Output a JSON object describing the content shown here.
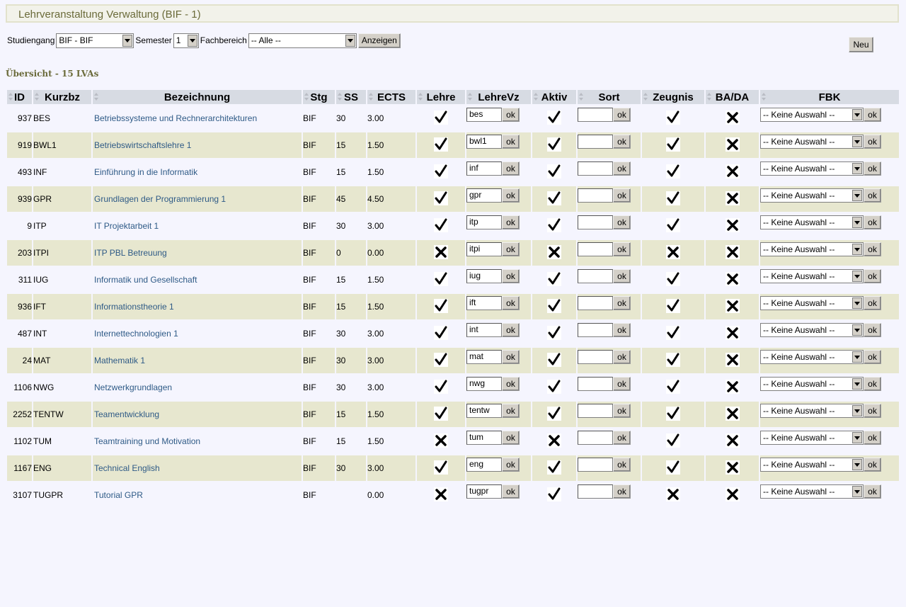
{
  "header": {
    "title": "Lehrveranstaltung Verwaltung (BIF - 1)"
  },
  "filters": {
    "studiengang_label": "Studiengang",
    "studiengang_value": "BIF - BIF",
    "semester_label": "Semester",
    "semester_value": "1",
    "fachbereich_label": "Fachbereich",
    "fachbereich_value": "-- Alle --",
    "show_button": "Anzeigen"
  },
  "new_button": "Neu",
  "overview": "Übersicht - 15 LVAs",
  "columns": [
    "ID",
    "Kurzbz",
    "Bezeichnung",
    "Stg",
    "SS",
    "ECTS",
    "Lehre",
    "LehreVz",
    "Aktiv",
    "Sort",
    "Zeugnis",
    "BA/DA",
    "FBK"
  ],
  "ok_label": "ok",
  "fbk_default": "-- Keine Auswahl --",
  "colors": {
    "check": "#000000",
    "row_alt": "#e7e7cf",
    "link": "#2e5a86",
    "title": "#6b6b3a"
  },
  "rows": [
    {
      "id": "937",
      "kurzbz": "BES",
      "bezeichnung": "Betriebssysteme und Rechnerarchitekturen",
      "stg": "BIF",
      "ss": "30",
      "ects": "3.00",
      "lehre": true,
      "lehrevz": "bes",
      "aktiv": true,
      "sort": "",
      "zeugnis": true,
      "bada": false
    },
    {
      "id": "919",
      "kurzbz": "BWL1",
      "bezeichnung": "Betriebswirtschaftslehre 1",
      "stg": "BIF",
      "ss": "15",
      "ects": "1.50",
      "lehre": true,
      "lehrevz": "bwl1",
      "aktiv": true,
      "sort": "",
      "zeugnis": true,
      "bada": false
    },
    {
      "id": "493",
      "kurzbz": "INF",
      "bezeichnung": "Einführung in die Informatik",
      "stg": "BIF",
      "ss": "15",
      "ects": "1.50",
      "lehre": true,
      "lehrevz": "inf",
      "aktiv": true,
      "sort": "",
      "zeugnis": true,
      "bada": false
    },
    {
      "id": "939",
      "kurzbz": "GPR",
      "bezeichnung": "Grundlagen der Programmierung 1",
      "stg": "BIF",
      "ss": "45",
      "ects": "4.50",
      "lehre": true,
      "lehrevz": "gpr",
      "aktiv": true,
      "sort": "",
      "zeugnis": true,
      "bada": false
    },
    {
      "id": "9",
      "kurzbz": "ITP",
      "bezeichnung": "IT Projektarbeit 1",
      "stg": "BIF",
      "ss": "30",
      "ects": "3.00",
      "lehre": true,
      "lehrevz": "itp",
      "aktiv": true,
      "sort": "",
      "zeugnis": true,
      "bada": false
    },
    {
      "id": "203",
      "kurzbz": "ITPI",
      "bezeichnung": "ITP PBL Betreuung",
      "stg": "BIF",
      "ss": "0",
      "ects": "0.00",
      "lehre": false,
      "lehrevz": "itpi",
      "aktiv": false,
      "sort": "",
      "zeugnis": false,
      "bada": false
    },
    {
      "id": "311",
      "kurzbz": "IUG",
      "bezeichnung": "Informatik und Gesellschaft",
      "stg": "BIF",
      "ss": "15",
      "ects": "1.50",
      "lehre": true,
      "lehrevz": "iug",
      "aktiv": true,
      "sort": "",
      "zeugnis": true,
      "bada": false
    },
    {
      "id": "936",
      "kurzbz": "IFT",
      "bezeichnung": "Informationstheorie 1",
      "stg": "BIF",
      "ss": "15",
      "ects": "1.50",
      "lehre": true,
      "lehrevz": "ift",
      "aktiv": true,
      "sort": "",
      "zeugnis": true,
      "bada": false
    },
    {
      "id": "487",
      "kurzbz": "INT",
      "bezeichnung": "Internettechnologien 1",
      "stg": "BIF",
      "ss": "30",
      "ects": "3.00",
      "lehre": true,
      "lehrevz": "int",
      "aktiv": true,
      "sort": "",
      "zeugnis": true,
      "bada": false
    },
    {
      "id": "24",
      "kurzbz": "MAT",
      "bezeichnung": "Mathematik 1",
      "stg": "BIF",
      "ss": "30",
      "ects": "3.00",
      "lehre": true,
      "lehrevz": "mat",
      "aktiv": true,
      "sort": "",
      "zeugnis": true,
      "bada": false
    },
    {
      "id": "1106",
      "kurzbz": "NWG",
      "bezeichnung": "Netzwerkgrundlagen",
      "stg": "BIF",
      "ss": "30",
      "ects": "3.00",
      "lehre": true,
      "lehrevz": "nwg",
      "aktiv": true,
      "sort": "",
      "zeugnis": true,
      "bada": false
    },
    {
      "id": "2252",
      "kurzbz": "TENTW",
      "bezeichnung": "Teamentwicklung",
      "stg": "BIF",
      "ss": "15",
      "ects": "1.50",
      "lehre": true,
      "lehrevz": "tentw",
      "aktiv": true,
      "sort": "",
      "zeugnis": true,
      "bada": false
    },
    {
      "id": "1102",
      "kurzbz": "TUM",
      "bezeichnung": "Teamtraining und Motivation",
      "stg": "BIF",
      "ss": "15",
      "ects": "1.50",
      "lehre": false,
      "lehrevz": "tum",
      "aktiv": false,
      "sort": "",
      "zeugnis": true,
      "bada": false
    },
    {
      "id": "1167",
      "kurzbz": "ENG",
      "bezeichnung": "Technical English",
      "stg": "BIF",
      "ss": "30",
      "ects": "3.00",
      "lehre": true,
      "lehrevz": "eng",
      "aktiv": true,
      "sort": "",
      "zeugnis": true,
      "bada": false
    },
    {
      "id": "3107",
      "kurzbz": "TUGPR",
      "bezeichnung": "Tutorial GPR",
      "stg": "BIF",
      "ss": "",
      "ects": "0.00",
      "lehre": false,
      "lehrevz": "tugpr",
      "aktiv": true,
      "sort": "",
      "zeugnis": false,
      "bada": false
    }
  ]
}
